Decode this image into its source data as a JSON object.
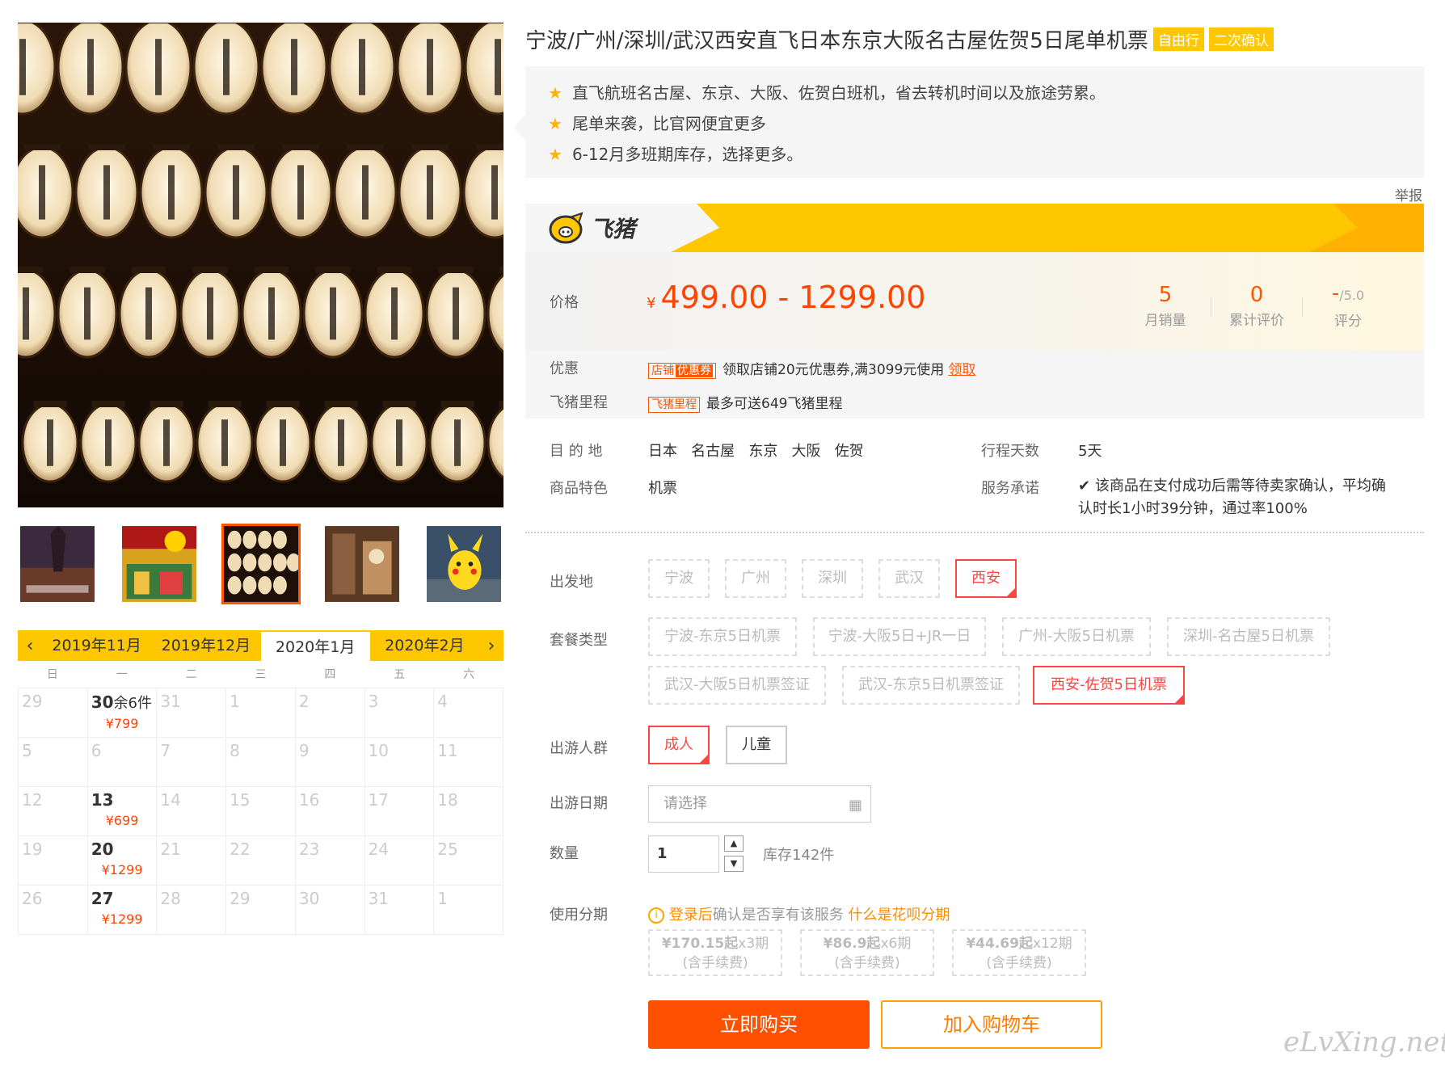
{
  "title": "宁波/广州/深圳/武汉西安直飞日本东京大阪名古屋佐贺5日尾单机票",
  "tags": [
    "自由行",
    "二次确认"
  ],
  "highlights": [
    "直飞航班名古屋、东京、大阪、佐贺白班机，省去转机时间以及旅途劳累。",
    "尾单来袭，比官网便宜更多",
    "6-12月多班期库存，选择更多。"
  ],
  "report": "举报",
  "brand": {
    "name": "飞猪"
  },
  "price": {
    "label": "价格",
    "currency": "¥",
    "value": "499.00 - 1299.00",
    "stats": [
      {
        "num": "5",
        "suffix": "",
        "cap": "月销量"
      },
      {
        "num": "0",
        "suffix": "",
        "cap": "累计评价"
      },
      {
        "num": "-",
        "suffix": "/5.0",
        "cap": "评分"
      }
    ]
  },
  "promo": {
    "coupon": {
      "label": "优惠",
      "tag1": "店铺",
      "tag2": "优惠券",
      "text": "领取店铺20元优惠券,满3099元使用",
      "link": "领取"
    },
    "miles": {
      "label": "飞猪里程",
      "tag": "飞猪里程",
      "text": "最多可送649飞猪里程"
    }
  },
  "info": {
    "dest_label": "目 的 地",
    "dest_values": [
      "日本",
      "名古屋",
      "东京",
      "大阪",
      "佐贺"
    ],
    "days_label": "行程天数",
    "days_value": "5天",
    "feature_label": "商品特色",
    "feature_value": "机票",
    "service_label": "服务承诺",
    "service_line1": "该商品在支付成功后需等待卖家确认，平均确",
    "service_line2": "认时长1小时39分钟，通过率100%"
  },
  "options": {
    "depart_label": "出发地",
    "departs": [
      "宁波",
      "广州",
      "深圳",
      "武汉",
      "西安"
    ],
    "depart_selected": "西安",
    "package_label": "套餐类型",
    "packages": [
      "宁波-东京5日机票",
      "宁波-大阪5日+JR一日",
      "广州-大阪5日机票",
      "深圳-名古屋5日机票",
      "武汉-大阪5日机票签证",
      "武汉-东京5日机票签证",
      "西安-佐贺5日机票"
    ],
    "package_selected": "西安-佐贺5日机票",
    "people_label": "出游人群",
    "people": [
      "成人",
      "儿童"
    ],
    "people_selected": "成人",
    "date_label": "出游日期",
    "date_placeholder": "请选择",
    "qty_label": "数量",
    "qty_value": "1",
    "stock": "库存142件",
    "installment_label": "使用分期",
    "installment_login": "登录后",
    "installment_note": "确认是否享有该服务",
    "installment_link": "什么是花呗分期",
    "installments": [
      {
        "amount": "¥170.15起",
        "term": "x3期",
        "fee": "(含手续费)"
      },
      {
        "amount": "¥86.9起",
        "term": "x6期",
        "fee": "(含手续费)"
      },
      {
        "amount": "¥44.69起",
        "term": "x12期",
        "fee": "(含手续费)"
      }
    ]
  },
  "actions": {
    "buy": "立即购买",
    "cart": "加入购物车"
  },
  "calendar": {
    "months": [
      "2019年11月",
      "2019年12月",
      "2020年1月",
      "2020年2月"
    ],
    "active_month": "2020年1月",
    "weekdays": [
      "日",
      "一",
      "二",
      "三",
      "四",
      "五",
      "六"
    ],
    "cells": [
      {
        "d": "29",
        "a": false
      },
      {
        "d": "30",
        "a": true,
        "rest": "余6件",
        "p": "¥799"
      },
      {
        "d": "31",
        "a": false
      },
      {
        "d": "1",
        "a": false
      },
      {
        "d": "2",
        "a": false
      },
      {
        "d": "3",
        "a": false
      },
      {
        "d": "4",
        "a": false
      },
      {
        "d": "5",
        "a": false
      },
      {
        "d": "6",
        "a": false
      },
      {
        "d": "7",
        "a": false
      },
      {
        "d": "8",
        "a": false
      },
      {
        "d": "9",
        "a": false
      },
      {
        "d": "10",
        "a": false
      },
      {
        "d": "11",
        "a": false
      },
      {
        "d": "12",
        "a": false
      },
      {
        "d": "13",
        "a": true,
        "p": "¥699"
      },
      {
        "d": "14",
        "a": false
      },
      {
        "d": "15",
        "a": false
      },
      {
        "d": "16",
        "a": false
      },
      {
        "d": "17",
        "a": false
      },
      {
        "d": "18",
        "a": false
      },
      {
        "d": "19",
        "a": false
      },
      {
        "d": "20",
        "a": true,
        "p": "¥1299"
      },
      {
        "d": "21",
        "a": false
      },
      {
        "d": "22",
        "a": false
      },
      {
        "d": "23",
        "a": false
      },
      {
        "d": "24",
        "a": false
      },
      {
        "d": "25",
        "a": false
      },
      {
        "d": "26",
        "a": false
      },
      {
        "d": "27",
        "a": true,
        "p": "¥1299"
      },
      {
        "d": "28",
        "a": false
      },
      {
        "d": "29",
        "a": false
      },
      {
        "d": "30",
        "a": false
      },
      {
        "d": "31",
        "a": false
      },
      {
        "d": "1",
        "a": false
      }
    ]
  },
  "watermark": "eLvXing.net",
  "colors": {
    "accent": "#ff5500",
    "brand_yellow": "#ffc700",
    "price": "#ff4400"
  }
}
